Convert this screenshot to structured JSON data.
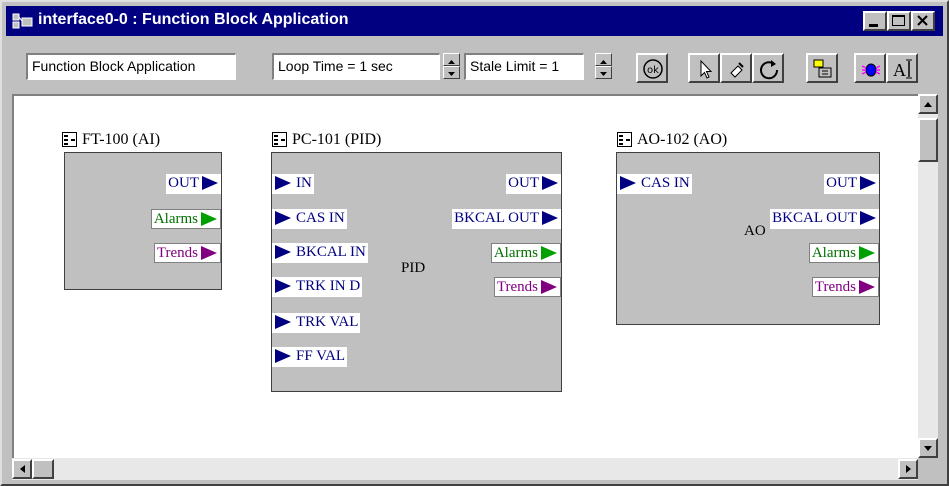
{
  "window": {
    "title": "interface0-0 : Function Block Application"
  },
  "toolbar": {
    "app_field": "Function Block Application",
    "loop_time": "Loop Time = 1 sec",
    "stale_limit": "Stale Limit = 1",
    "buttons": [
      "ok-icon",
      "pointer-icon",
      "connect-icon",
      "rotate-icon",
      "download-icon",
      "debug-icon",
      "text-icon"
    ]
  },
  "canvas": {
    "blocks": [
      {
        "title": "FT-100 (AI)",
        "inputs": [],
        "outputs": [
          {
            "label": "OUT",
            "type": "normal"
          },
          {
            "label": "Alarms",
            "type": "alarm"
          },
          {
            "label": "Trends",
            "type": "trend"
          }
        ],
        "body_label": ""
      },
      {
        "title": "PC-101 (PID)",
        "inputs": [
          "IN",
          "CAS IN",
          "BKCAL IN",
          "TRK IN D",
          "TRK VAL",
          "FF VAL"
        ],
        "outputs": [
          {
            "label": "OUT",
            "type": "normal"
          },
          {
            "label": "BKCAL OUT",
            "type": "normal"
          },
          {
            "label": "Alarms",
            "type": "alarm"
          },
          {
            "label": "Trends",
            "type": "trend"
          }
        ],
        "body_label": "PID"
      },
      {
        "title": "AO-102 (AO)",
        "inputs": [
          "CAS IN"
        ],
        "outputs": [
          {
            "label": "OUT",
            "type": "normal"
          },
          {
            "label": "BKCAL OUT",
            "type": "normal"
          },
          {
            "label": "Alarms",
            "type": "alarm"
          },
          {
            "label": "Trends",
            "type": "trend"
          }
        ],
        "body_label": "AO"
      }
    ]
  },
  "colors": {
    "titlebar": "#000080",
    "port_arrow": "#000080",
    "alarm": "#007000",
    "trend": "#800080"
  }
}
